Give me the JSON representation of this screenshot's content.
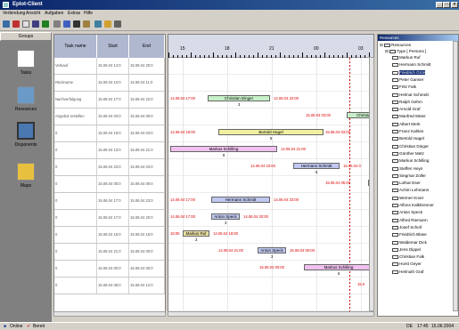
{
  "window": {
    "title": "Eplot-Client"
  },
  "menu": [
    "Verbindung",
    "Ansicht",
    "Aufgaben",
    "Extras",
    "Hilfe"
  ],
  "groups": {
    "header": "Groups",
    "items": [
      {
        "label": "Tasks",
        "icon": "tasks-icon",
        "active": false
      },
      {
        "label": "Resources",
        "icon": "resources-icon",
        "active": false
      },
      {
        "label": "Disponents",
        "icon": "disponents-icon",
        "active": true
      },
      {
        "label": "Maps",
        "icon": "maps-icon",
        "active": false
      }
    ]
  },
  "task_grid": {
    "headers": [
      "Task name",
      "Start",
      "End"
    ],
    "rows": [
      [
        "Verkauf",
        "15.06.04 14:0",
        "15.06.04 20:0"
      ],
      [
        "Rückname",
        "15.06.04 10:0",
        "15.06.04 11:0"
      ],
      [
        "Nachverfolgung",
        "15.06.04 17:0",
        "15.06.04 22:0"
      ],
      [
        "Angebot erstellen",
        "15.06.04 03:0",
        "15.06.04 09:0"
      ],
      [
        "0",
        "15.06.04 18:0",
        "15.06.04 03:0"
      ],
      [
        "0",
        "15.06.04 13:0",
        "15.06.04 21:0"
      ],
      [
        "0",
        "15.06.04 23:0",
        "15.06.04 04:0"
      ],
      [
        "0",
        "15.06.04 05:0",
        "15.06.04 09:0"
      ],
      [
        "0",
        "15.06.04 17:0",
        "15.06.04 23:0"
      ],
      [
        "0",
        "15.06.04 17:0",
        "15.06.04 20:0"
      ],
      [
        "0",
        "15.06.04 15:0",
        "15.06.04 18:0"
      ],
      [
        "0",
        "15.06.04 21:0",
        "15.06.04 00:0"
      ],
      [
        "0",
        "15.06.04 00:0",
        "15.06.04 06:0"
      ],
      [
        "0",
        "15.06.04 08:0",
        "15.06.04 12:0"
      ]
    ]
  },
  "gantt": {
    "ticks": [
      "15",
      "18",
      "21",
      "00",
      "03"
    ],
    "bars": [
      {
        "row": 2,
        "start_label": "14.06.04 17:00",
        "name": "Christian Dinger",
        "end_label": "14.06.04 22:00",
        "num": "3",
        "color": "#c8f0c8"
      },
      {
        "row": 3,
        "start_label": "15.06.04 03:00",
        "name": "Christian",
        "end_label": "",
        "num": "",
        "color": "#c8f0c8"
      },
      {
        "row": 4,
        "start_label": "14.06.04 18:00",
        "name": "Bertold Hagel",
        "end_label": "15.06.04 03:00",
        "num": "8",
        "color": "#f0f0a0"
      },
      {
        "row": 5,
        "start_label": "",
        "name": "Markus Schilling",
        "end_label": "14.06.04 21:00",
        "num": "8",
        "color": "#f0c0f0"
      },
      {
        "row": 6,
        "start_label": "14.06.04 23:00",
        "name": "Hermann Schmitt",
        "end_label": "15.06.04 0",
        "num": "5",
        "color": "#c0c8f0"
      },
      {
        "row": 7,
        "start_label": "15.06.04 05:00",
        "name": "",
        "end_label": "",
        "num": "",
        "color": "#c0c8f0"
      },
      {
        "row": 8,
        "start_label": "14.06.04 17:00",
        "name": "Hermann Schmitt",
        "end_label": "14.06.04 23:00",
        "num": "",
        "color": "#c0c8f0"
      },
      {
        "row": 9,
        "start_label": "14.06.04 17:00",
        "name": "Anton Speck",
        "end_label": "14.06.04 20:00",
        "num": "3",
        "color": "#c0c8f0"
      },
      {
        "row": 10,
        "start_label": "15:00",
        "name": "Markus Ruf",
        "end_label": "14.06.04 18:00",
        "num": "3",
        "color": "#e8e0a0"
      },
      {
        "row": 11,
        "start_label": "14.06.04 21:00",
        "name": "Anton Speck",
        "end_label": "15.06.04 00:00",
        "num": "3",
        "color": "#c0c8f0"
      },
      {
        "row": 12,
        "start_label": "15.06.04 00:00",
        "name": "Markus Schilling",
        "end_label": "",
        "num": "6",
        "color": "#f0c0f0"
      },
      {
        "row": 13,
        "start_label": "15.0",
        "name": "",
        "end_label": "",
        "num": "",
        "color": "#c0c8f0"
      }
    ]
  },
  "resources": {
    "header": "Resources",
    "root": "Resources",
    "type_node": "Type [ Persons ]",
    "people": [
      "Markus Ruf",
      "Hermann Schmitt",
      "Friedrich Grün",
      "Peter Ganser",
      "Fritz Falk",
      "Helmut Schmelz",
      "Ralph Gehm",
      "Arnold Graf",
      "Manfred Meier",
      "Albert Merk",
      "Franz Kahlen",
      "Bertold Hagel",
      "Christian Dinger",
      "Günther Metz",
      "Markus Schilling",
      "Steffen Heyn",
      "Siegmar Zoller",
      "Lothar Eser",
      "Achim Lehmann",
      "Werner Knorr",
      "Alfons Kalkbrenner",
      "Anton Speck",
      "Alfred Riemann",
      "Josef Scholl",
      "Friedrich Blase",
      "Waldemar Dick",
      "Jens Dippel",
      "Christian Falk",
      "Horst Geyer",
      "Helmuth Graf"
    ],
    "selected": "Friedrich Grün"
  },
  "status": {
    "connection": "Online",
    "state": "Bereit",
    "lang": "DE",
    "time": "17:45",
    "date": "15.06.2004"
  },
  "colors": {
    "title_bar": "#0a246a",
    "grid_header": "#b0b8d0",
    "deadline": "#cc0000"
  }
}
